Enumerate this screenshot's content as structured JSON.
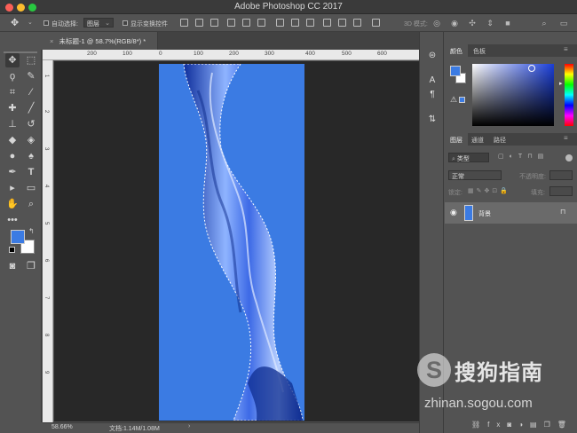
{
  "titlebar": {
    "title": "Adobe Photoshop CC 2017"
  },
  "optionsbar": {
    "auto_select_label": "自动选择:",
    "auto_select_value": "图层",
    "show_transform_label": "显示变换控件",
    "mode_3d_label": "3D 模式:"
  },
  "document": {
    "tab_label": "未标题-1 @ 58.7%(RGB/8*) *",
    "ruler_top": [
      "200",
      "100",
      "0",
      "100",
      "200",
      "300",
      "400",
      "500",
      "600"
    ],
    "ruler_left": [
      "1",
      "2",
      "3",
      "4",
      "5",
      "6",
      "7",
      "8",
      "9"
    ],
    "canvas_color": "#3b7be3"
  },
  "statusbar": {
    "zoom": "58.66%",
    "doc_info": "文档:1.14M/1.08M"
  },
  "colors_panel": {
    "tabs": [
      "颜色",
      "色板"
    ],
    "foreground": "#3b7be3",
    "background": "#ffffff"
  },
  "layers_panel": {
    "tabs": [
      "图层",
      "通道",
      "路径"
    ],
    "filter_label": "类型",
    "blend_mode": "正常",
    "opacity_label": "不透明度:",
    "lock_label": "锁定:",
    "fill_label": "填充:",
    "layers": [
      {
        "name": "背景"
      }
    ]
  },
  "watermark": {
    "cn": "搜狗指南",
    "en": "zhinan.sogou.com",
    "logo_letter": "S"
  }
}
